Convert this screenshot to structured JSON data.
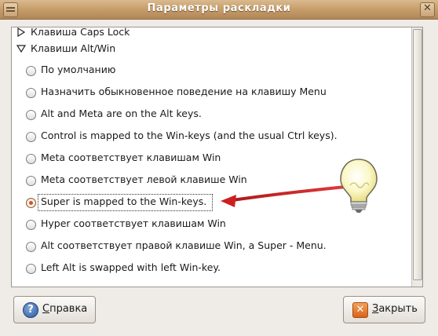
{
  "window": {
    "title": "Параметры раскладки",
    "menu_icon": "window-menu-icon",
    "close_icon": "window-close-icon"
  },
  "tree": {
    "collapsed_group": "Клавиша Caps Lock",
    "expanded_group": "Клавиши Alt/Win",
    "options": [
      {
        "label": "По умолчанию",
        "selected": false
      },
      {
        "label": "Назначить обыкновенное поведение на клавишу Menu",
        "selected": false
      },
      {
        "label": "Alt and Meta are on the Alt keys.",
        "selected": false
      },
      {
        "label": "Control is mapped to the Win-keys (and the usual Ctrl keys).",
        "selected": false
      },
      {
        "label": "Meta соответствует клавишам Win",
        "selected": false
      },
      {
        "label": "Meta соответствует левой клавише Win",
        "selected": false
      },
      {
        "label": "Super is mapped to the Win-keys.",
        "selected": true
      },
      {
        "label": "Hyper соответствует клавишам Win",
        "selected": false
      },
      {
        "label": "Alt соответствует правой клавише Win, а Super - Menu.",
        "selected": false
      },
      {
        "label": "Left Alt is swapped with left Win-key.",
        "selected": false
      }
    ]
  },
  "buttons": {
    "help": {
      "mnemonic": "С",
      "rest": "правка",
      "icon": "help-icon"
    },
    "close": {
      "mnemonic": "З",
      "rest": "акрыть",
      "icon": "close-icon"
    }
  },
  "annotation": {
    "icon": "lightbulb-icon",
    "arrow": "red-arrow-icon",
    "arrow_color": "#cc2020"
  },
  "colors": {
    "titlebar": "#c49a66",
    "radio_selected": "#d2552b"
  }
}
